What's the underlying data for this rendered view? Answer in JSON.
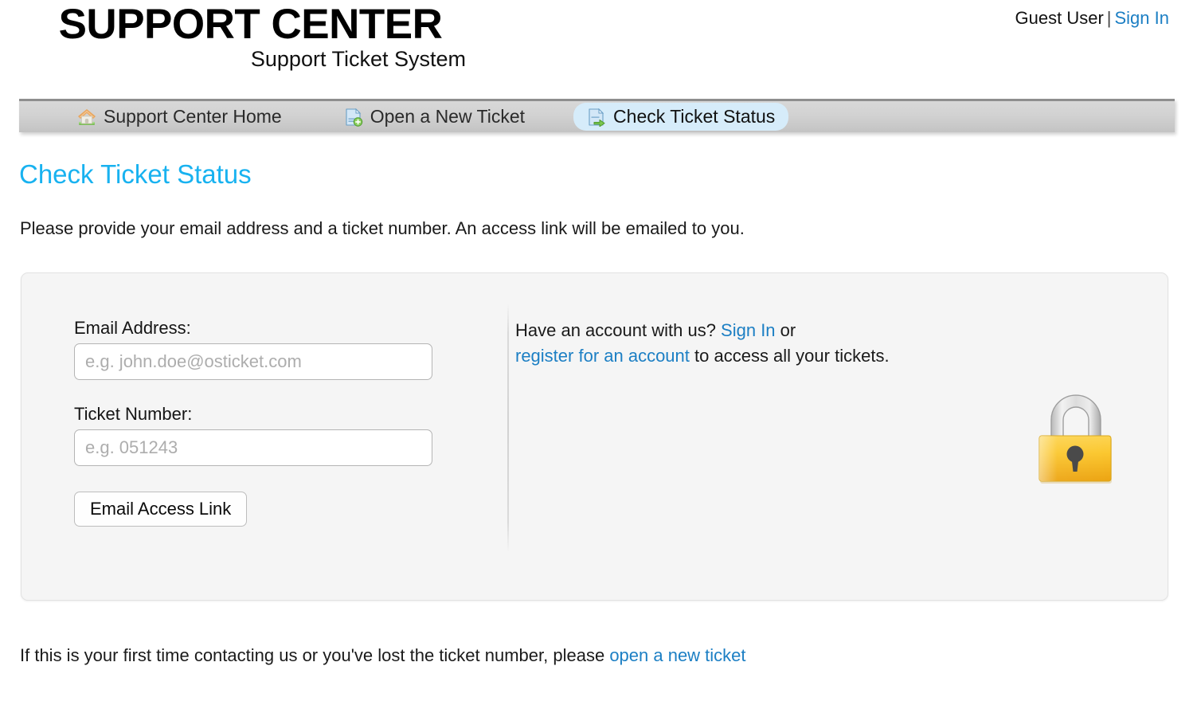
{
  "header": {
    "logo_title": "SUPPORT CENTER",
    "logo_subtitle": "Support Ticket System",
    "user_name": "Guest User",
    "separator": "|",
    "sign_in_label": "Sign In"
  },
  "nav": {
    "items": [
      {
        "label": "Support Center Home",
        "icon": "home-icon",
        "active": false
      },
      {
        "label": "Open a New Ticket",
        "icon": "new-ticket-icon",
        "active": false
      },
      {
        "label": "Check Ticket Status",
        "icon": "check-status-icon",
        "active": true
      }
    ]
  },
  "page": {
    "title": "Check Ticket Status",
    "description": "Please provide your email address and a ticket number. An access link will be emailed to you."
  },
  "form": {
    "email_label": "Email Address:",
    "email_value": "",
    "email_placeholder": "e.g. john.doe@osticket.com",
    "ticket_label": "Ticket Number:",
    "ticket_value": "",
    "ticket_placeholder": "e.g. 051243",
    "submit_label": "Email Access Link"
  },
  "account": {
    "lead_text": "Have an account with us? ",
    "sign_in_label": "Sign In",
    "or_text": " or",
    "register_label": "register for an account",
    "tail_text": " to access all your tickets.",
    "lock_icon": "padlock-icon"
  },
  "footer": {
    "text_before": "If this is your first time contacting us or you've lost the ticket number, please ",
    "link_label": "open a new ticket"
  },
  "colors": {
    "link_blue": "#1C7FC4",
    "title_cyan": "#18B2F0",
    "active_tab_bg": "#d6ecfa",
    "navbar_gray": "#d2d2d2",
    "panel_bg": "#f5f5f5",
    "lock_gold": "#f6c42a",
    "lock_silver": "#cfcfcf"
  }
}
